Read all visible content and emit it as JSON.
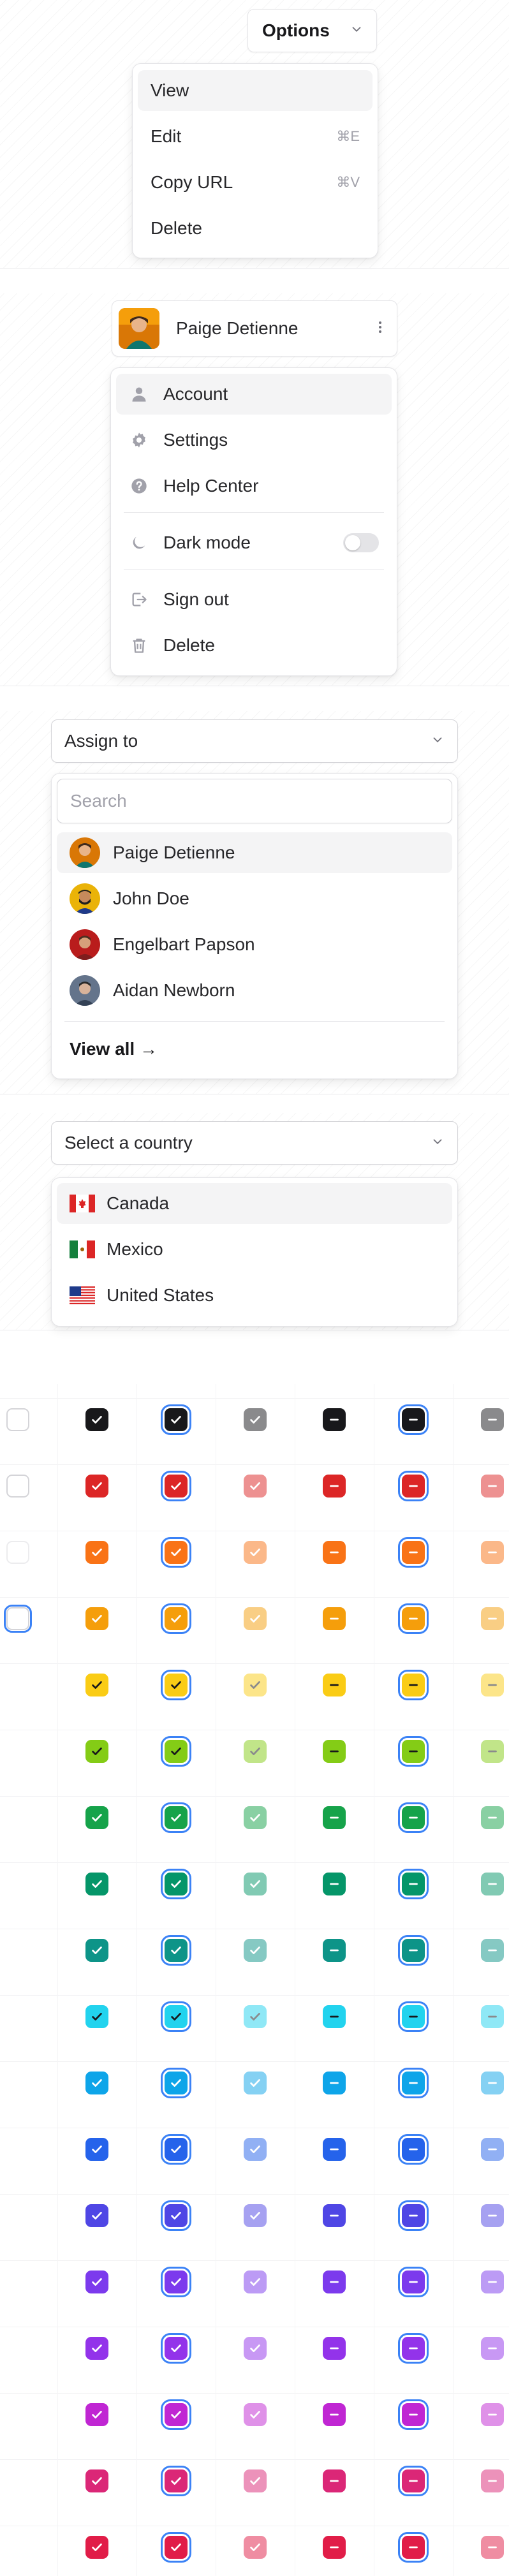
{
  "options_menu": {
    "trigger_label": "Options",
    "items": [
      {
        "label": "View",
        "shortcut": "",
        "highlighted": true
      },
      {
        "label": "Edit",
        "shortcut": "⌘E",
        "highlighted": false
      },
      {
        "label": "Copy URL",
        "shortcut": "⌘V",
        "highlighted": false
      },
      {
        "label": "Delete",
        "shortcut": "",
        "highlighted": false
      }
    ]
  },
  "account_menu": {
    "user_name": "Paige Detienne",
    "items": [
      {
        "label": "Account",
        "icon": "user-icon",
        "highlighted": true
      },
      {
        "label": "Settings",
        "icon": "gear-icon",
        "highlighted": false
      },
      {
        "label": "Help Center",
        "icon": "help-icon",
        "highlighted": false
      },
      {
        "label": "Dark mode",
        "icon": "moon-icon",
        "toggle": false
      },
      {
        "label": "Sign out",
        "icon": "sign-out-icon"
      },
      {
        "label": "Delete",
        "icon": "trash-icon"
      }
    ]
  },
  "assign_menu": {
    "trigger_label": "Assign to",
    "search_placeholder": "Search",
    "people": [
      {
        "name": "Paige Detienne",
        "highlighted": true
      },
      {
        "name": "John Doe",
        "highlighted": false
      },
      {
        "name": "Engelbart Papson",
        "highlighted": false
      },
      {
        "name": "Aidan Newborn",
        "highlighted": false
      }
    ],
    "view_all_label": "View all →"
  },
  "country_menu": {
    "trigger_label": "Select a country",
    "countries": [
      {
        "name": "Canada",
        "flag": "canada-flag",
        "highlighted": true
      },
      {
        "name": "Mexico",
        "flag": "mexico-flag",
        "highlighted": false
      },
      {
        "name": "United States",
        "flag": "us-flag",
        "highlighted": false
      }
    ]
  },
  "checkbox_grid": {
    "first_column_states": [
      "unchecked",
      "unchecked",
      "unchecked-disabled",
      "unchecked-focused"
    ],
    "color_rows": [
      "#18181b",
      "#dc2626",
      "#f97316",
      "#f59e0b",
      "#facc15",
      "#84cc16",
      "#16a34a",
      "#059669",
      "#0d9488",
      "#22d3ee",
      "#0ea5e9",
      "#2563eb",
      "#4f46e5",
      "#7c3aed",
      "#9333ea",
      "#c026d3",
      "#db2777",
      "#e11d48"
    ]
  }
}
